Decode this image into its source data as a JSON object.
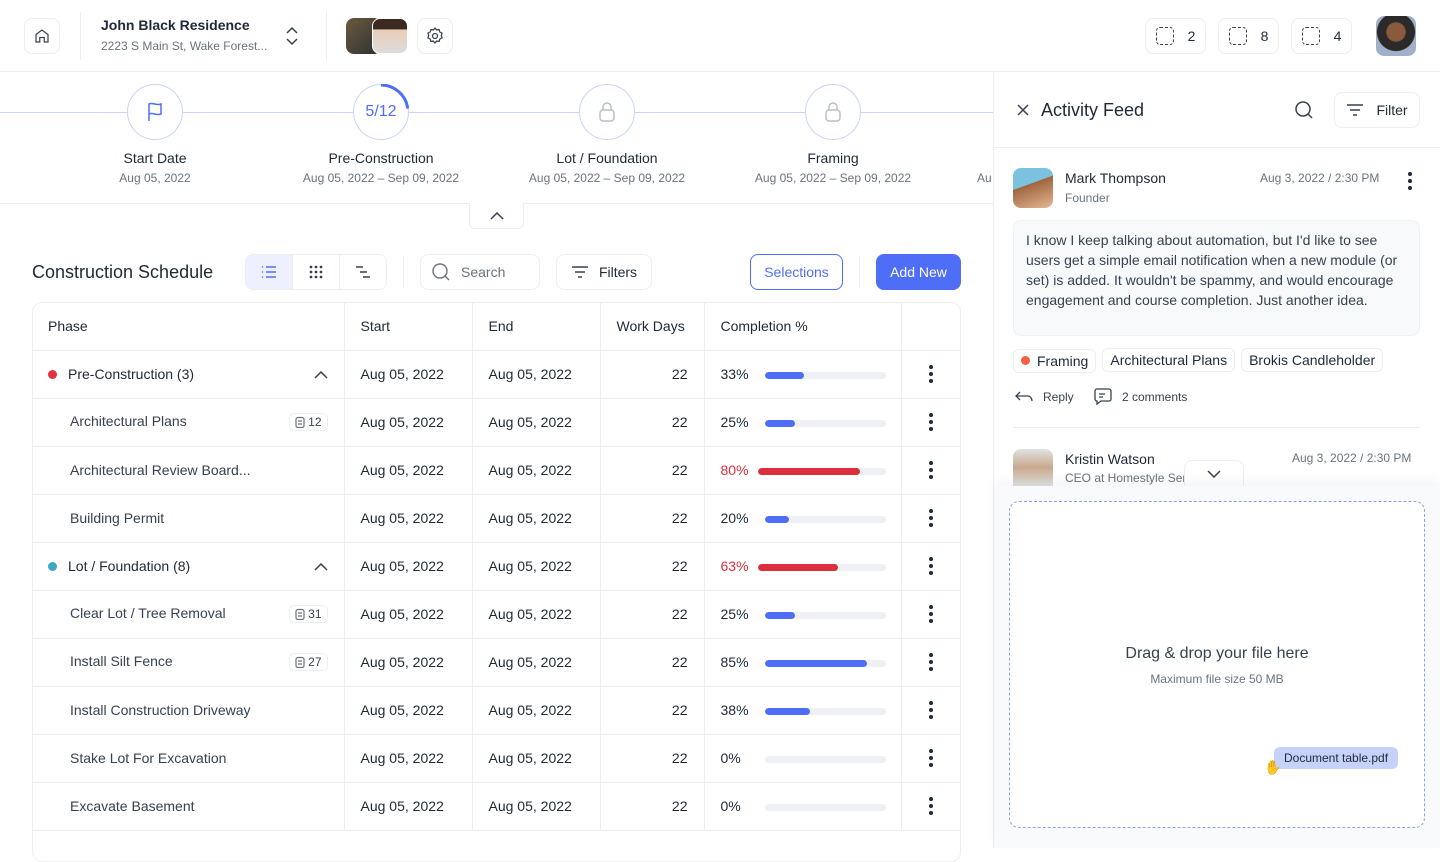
{
  "header": {
    "project_name": "John Black Residence",
    "project_address": "2223 S Main St, Wake Forest...",
    "counters": [
      {
        "icon": "dashed-square-icon",
        "value": "2"
      },
      {
        "icon": "dashed-square-icon",
        "value": "8"
      },
      {
        "icon": "dashed-square-icon",
        "value": "4"
      }
    ]
  },
  "timeline": [
    {
      "label": "Start Date",
      "date": "Aug 05, 2022",
      "icon": "flag-icon"
    },
    {
      "label": "Pre-Construction",
      "date": "Aug 05, 2022 – Sep 09, 2022",
      "progress_text": "5/12",
      "progress": 0.4167
    },
    {
      "label": "Lot / Foundation",
      "date": "Aug 05, 2022 – Sep 09, 2022",
      "icon": "lock-icon"
    },
    {
      "label": "Framing",
      "date": "Aug 05, 2022 – Sep 09, 2022",
      "icon": "lock-icon"
    },
    {
      "label": "",
      "date": "Au"
    }
  ],
  "schedule": {
    "title": "Construction Schedule",
    "search_placeholder": "Search",
    "filters_label": "Filters",
    "selections_label": "Selections",
    "add_new_label": "Add New",
    "columns": [
      "Phase",
      "Start",
      "End",
      "Work Days",
      "Completion %"
    ],
    "rows": [
      {
        "type": "group",
        "name": "Pre-Construction (3)",
        "dot": "#e0323f",
        "start": "Aug 05, 2022",
        "end": "Aug 05, 2022",
        "days": "22",
        "pct": 33
      },
      {
        "type": "item",
        "name": "Architectural Plans",
        "badge": "12",
        "start": "Aug 05, 2022",
        "end": "Aug 05, 2022",
        "days": "22",
        "pct": 25
      },
      {
        "type": "item",
        "name": "Architectural Review Board...",
        "start": "Aug 05, 2022",
        "end": "Aug 05, 2022",
        "days": "22",
        "pct": 80,
        "alert": true
      },
      {
        "type": "item",
        "name": "Building Permit",
        "start": "Aug 05, 2022",
        "end": "Aug 05, 2022",
        "days": "22",
        "pct": 20
      },
      {
        "type": "group",
        "name": "Lot / Foundation (8)",
        "dot": "#3aa8c1",
        "start": "Aug 05, 2022",
        "end": "Aug 05, 2022",
        "days": "22",
        "pct": 63,
        "alert": true
      },
      {
        "type": "item",
        "name": "Clear Lot / Tree Removal",
        "badge": "31",
        "start": "Aug 05, 2022",
        "end": "Aug 05, 2022",
        "days": "22",
        "pct": 25
      },
      {
        "type": "item",
        "name": "Install Silt Fence",
        "badge": "27",
        "start": "Aug 05, 2022",
        "end": "Aug 05, 2022",
        "days": "22",
        "pct": 85
      },
      {
        "type": "item",
        "name": "Install Construction Driveway",
        "start": "Aug 05, 2022",
        "end": "Aug 05, 2022",
        "days": "22",
        "pct": 38
      },
      {
        "type": "item",
        "name": "Stake Lot For Excavation",
        "start": "Aug 05, 2022",
        "end": "Aug 05, 2022",
        "days": "22",
        "pct": 0
      },
      {
        "type": "item",
        "name": "Excavate Basement",
        "start": "Aug 05, 2022",
        "end": "Aug 05, 2022",
        "days": "22",
        "pct": 0
      }
    ]
  },
  "feed": {
    "title": "Activity Feed",
    "filter_label": "Filter",
    "post": {
      "name": "Mark Thompson",
      "role": "Founder",
      "time": "Aug 3, 2022 / 2:30 PM",
      "text": "I know I keep talking about automation, but I'd like to see users get a simple email notification when a new module (or set) is added. It wouldn't be spammy, and would encourage engagement and course completion. Just another idea.",
      "tags": [
        "Framing",
        "Architectural Plans",
        "Brokis Candleholder"
      ],
      "reply_label": "Reply",
      "comments_label": "2 comments"
    },
    "post2": {
      "name": "Kristin Watson",
      "role": "CEO at Homestyle Ser",
      "time": "Aug 3, 2022 / 2:30 PM"
    },
    "upload": {
      "title": "Drag & drop your file here",
      "subtitle": "Maximum file size 50 MB",
      "file_chip": "Document table.pdf"
    }
  },
  "colors": {
    "accent": "#4f6ef7",
    "alert": "#dc2f3c",
    "tag_dot": "#f4613f"
  }
}
